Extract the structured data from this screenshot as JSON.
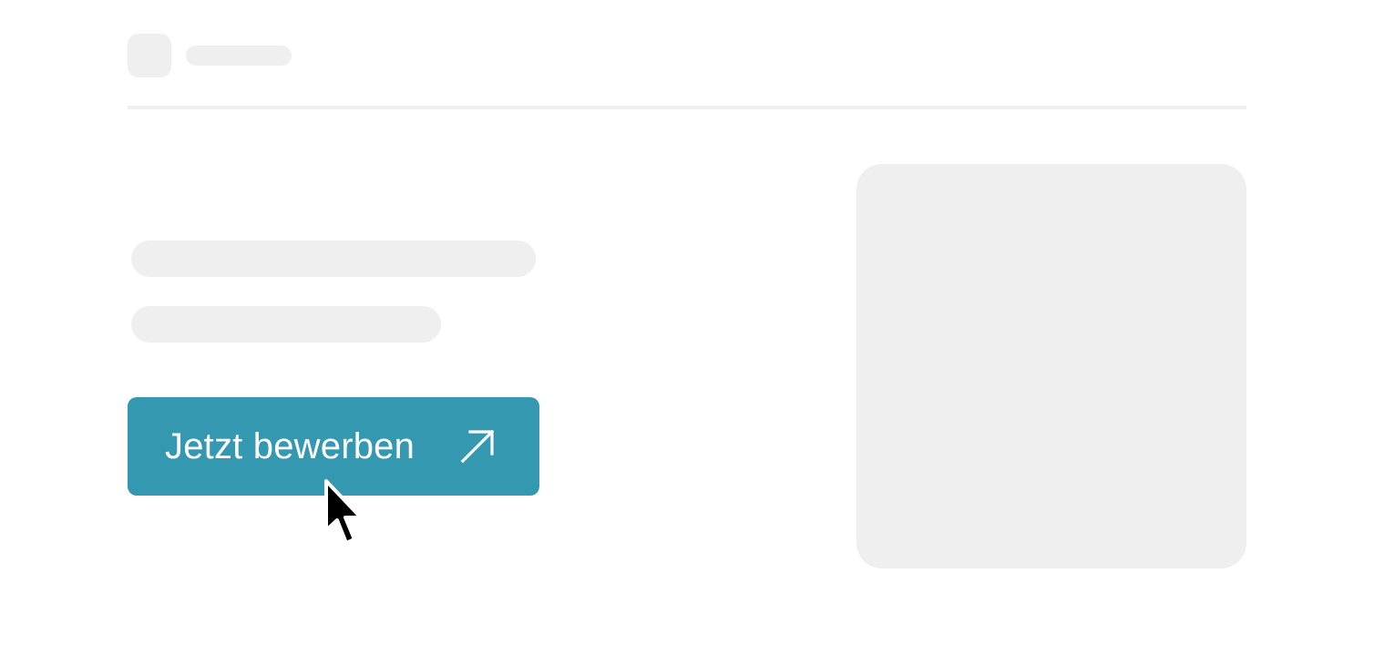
{
  "header": {
    "logo": "logo-placeholder",
    "brand": "brand-placeholder"
  },
  "main": {
    "cta": {
      "label": "Jetzt bewerben",
      "icon": "arrow-up-right-icon"
    }
  },
  "cursor": {
    "icon": "mouse-pointer-icon"
  },
  "colors": {
    "accent": "#3499b0",
    "skeleton": "#efefef",
    "background": "#ffffff"
  }
}
